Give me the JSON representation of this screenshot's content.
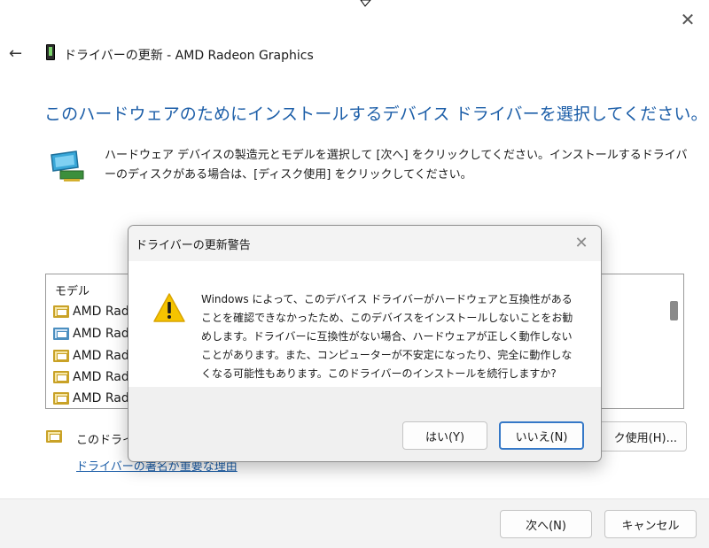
{
  "window": {
    "title": "ドライバーの更新 - AMD Radeon Graphics",
    "close_glyph": "✕",
    "back_glyph": "←"
  },
  "main": {
    "heading": "このハードウェアのためにインストールするデバイス ドライバーを選択してください。",
    "description": "ハードウェア デバイスの製造元とモデルを選択して [次へ] をクリックしてください。インストールするドライバーのディスクがある場合は、[ディスク使用] をクリックしてください。",
    "model_header": "モデル",
    "models": [
      "AMD Rad",
      "AMD Rad",
      "AMD Rad",
      "AMD Rad",
      "AMD Rad"
    ],
    "signed_text": "このドライ",
    "why_link": "ドライバーの署名が重要な理由",
    "disk_button": "ク使用(H)..."
  },
  "footer": {
    "next": "次へ(N)",
    "cancel": "キャンセル"
  },
  "dialog": {
    "title": "ドライバーの更新警告",
    "close_glyph": "✕",
    "message": "Windows によって、このデバイス ドライバーがハードウェアと互換性があることを確認できなかったため、このデバイスをインストールしないことをお勧めします。ドライバーに互換性がない場合、ハードウェアが正しく動作しないことがあります。また、コンピューターが不安定になったり、完全に動作しなくなる可能性もあります。このドライバーのインストールを続行しますか?",
    "yes": "はい(Y)",
    "no": "いいえ(N)"
  },
  "colors": {
    "accent": "#1c5ea8",
    "focus": "#3578c7",
    "warning": "#f5c400"
  }
}
